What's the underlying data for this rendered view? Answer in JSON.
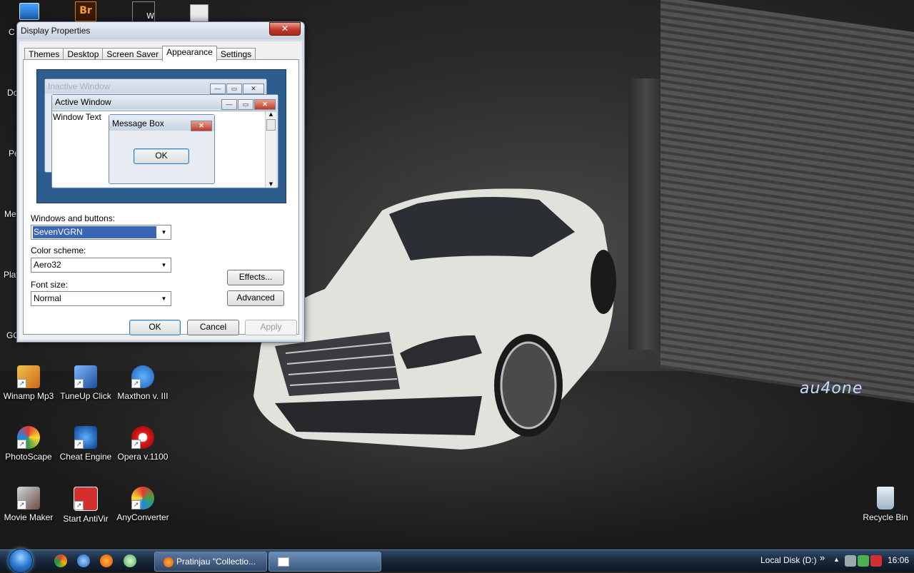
{
  "desktop": {
    "left_edge_labels": [
      "C",
      "Do",
      "Pe",
      "Me",
      "Play",
      "GO"
    ],
    "top_icon_labels": [
      "Br",
      "W"
    ],
    "icons": [
      {
        "label": "Winamp Mp3",
        "icon": "winamp-icon"
      },
      {
        "label": "TuneUp Click",
        "icon": "tuneup-icon"
      },
      {
        "label": "Maxthon v. III",
        "icon": "maxthon-icon"
      },
      {
        "label": "PhotoScape",
        "icon": "photoscape-icon"
      },
      {
        "label": "Cheat Engine",
        "icon": "cheat-engine-icon"
      },
      {
        "label": "Opera v.1100",
        "icon": "opera-icon"
      },
      {
        "label": "Movie Maker",
        "icon": "movie-maker-icon"
      },
      {
        "label": "Start AntiVir",
        "icon": "antivir-icon"
      },
      {
        "label": "AnyConverter",
        "icon": "anyconverter-icon"
      }
    ],
    "recycle_bin": "Recycle Bin",
    "brand_text": "au4one"
  },
  "dialog": {
    "title": "Display Properties",
    "close_glyph": "✕",
    "tabs": [
      "Themes",
      "Desktop",
      "Screen Saver",
      "Appearance",
      "Settings"
    ],
    "active_tab": "Appearance",
    "preview": {
      "inactive_title": "Inactive Window",
      "active_title": "Active Window",
      "window_text": "Window Text",
      "message_box_title": "Message Box",
      "message_ok": "OK",
      "min_glyph": "—",
      "max_glyph": "▭",
      "close_glyph": "✕"
    },
    "windows_buttons_label": "Windows and buttons:",
    "windows_buttons_value": "SevenVGRN",
    "color_scheme_label": "Color scheme:",
    "color_scheme_value": "Aero32",
    "font_size_label": "Font size:",
    "font_size_value": "Normal",
    "effects_button": "Effects...",
    "advanced_button": "Advanced",
    "ok_button": "OK",
    "cancel_button": "Cancel",
    "apply_button": "Apply"
  },
  "taskbar": {
    "task_buttons": [
      "Pratinjau \"Collectio...",
      ""
    ],
    "tray_label": "Local Disk (D:)",
    "tray_chevron": "»",
    "clock": "16:06"
  },
  "colors": {
    "taskbar": "#18273b",
    "dialog_frame": "#d6dbe3",
    "preview_bg": "#2d5c8f",
    "close_red": "#c0392b",
    "selection": "#3a66b6"
  }
}
